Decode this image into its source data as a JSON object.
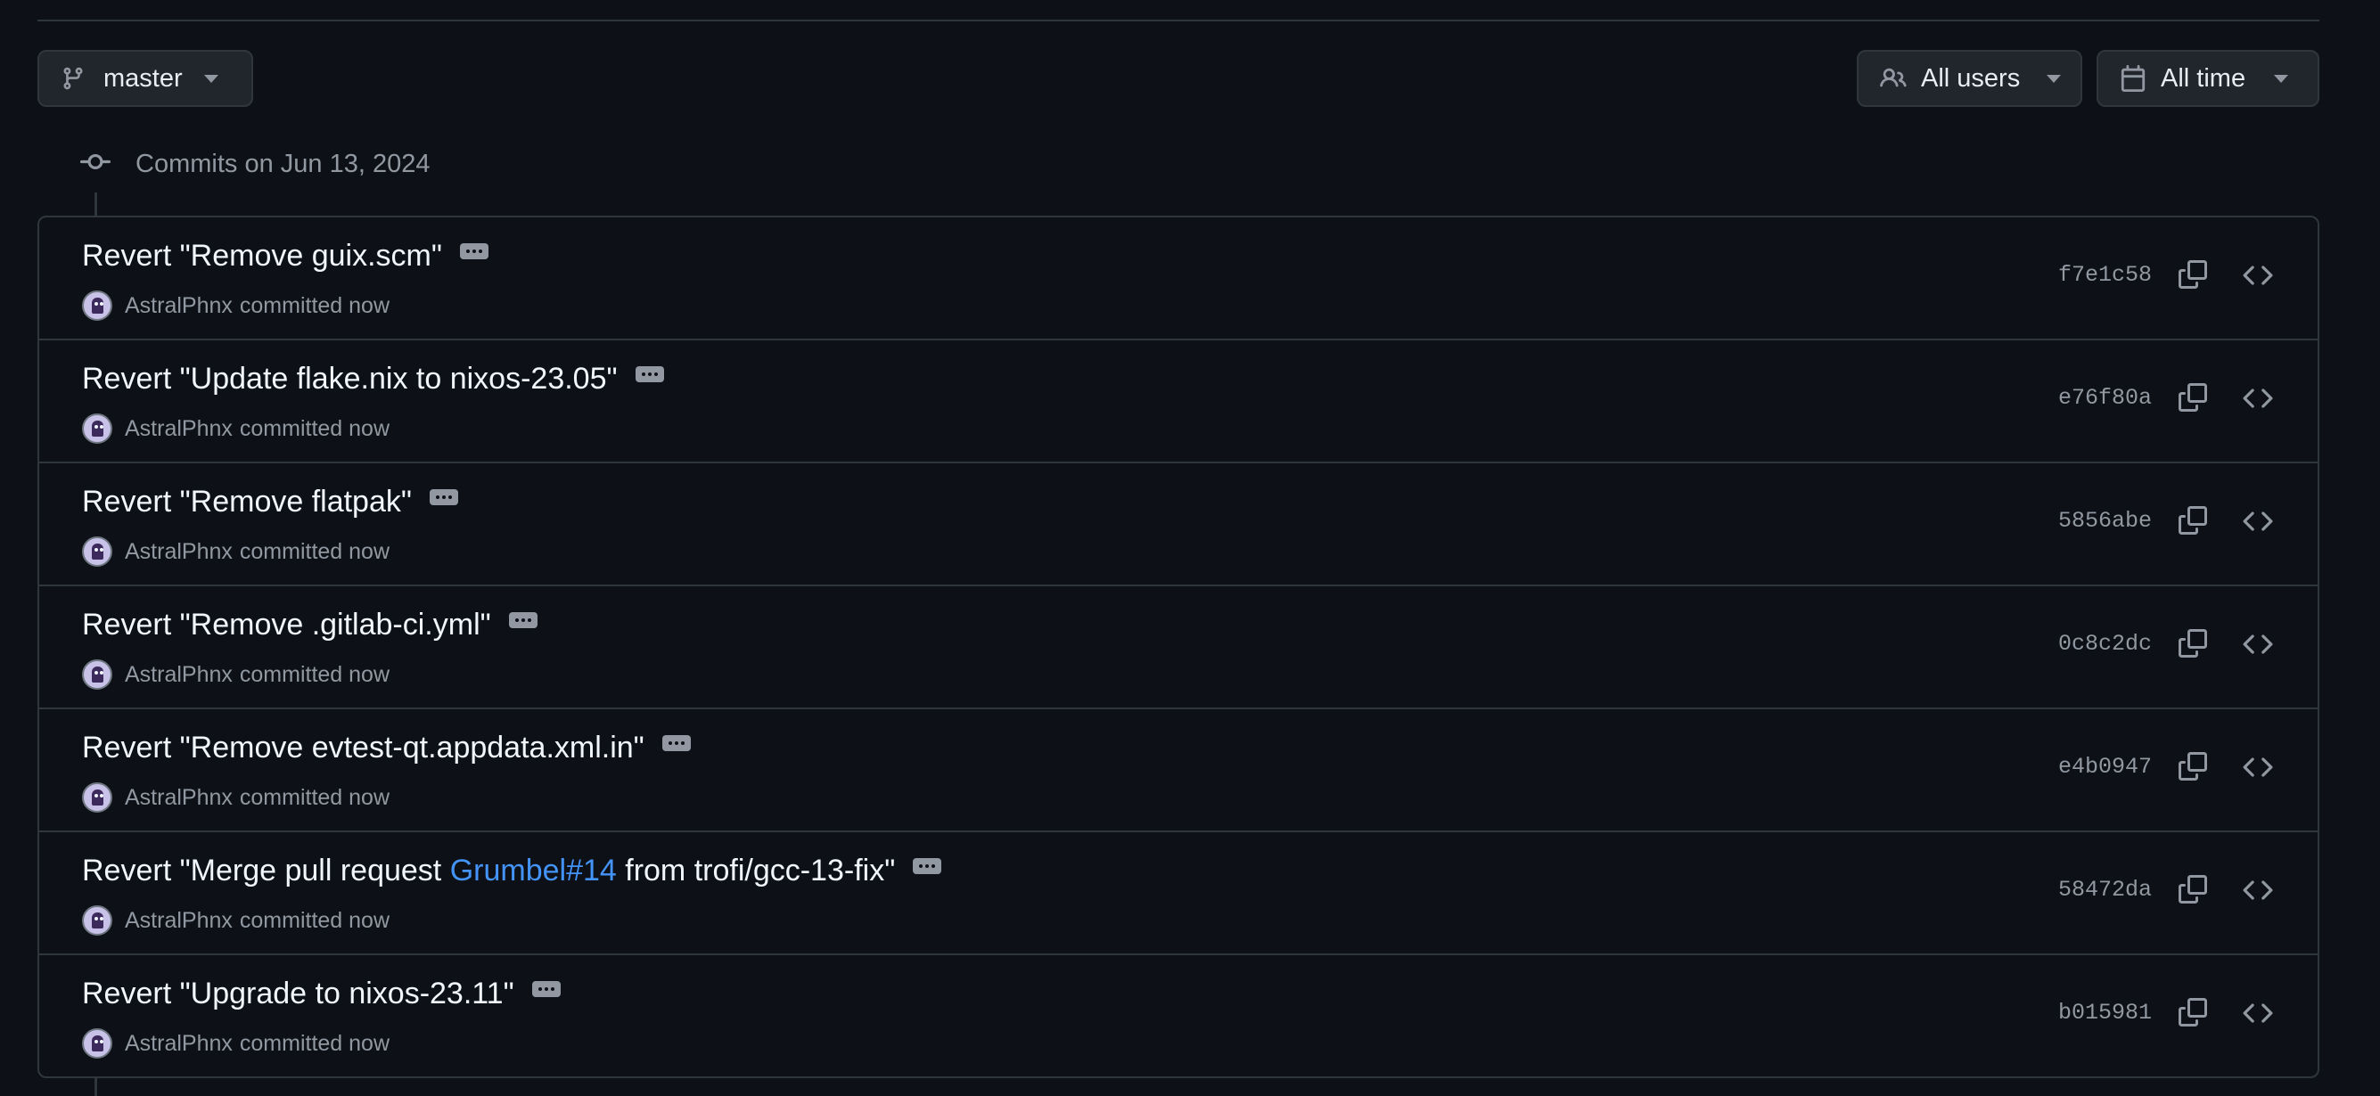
{
  "toolbar": {
    "branch_label": "master",
    "users_label": "All users",
    "time_label": "All time"
  },
  "group": {
    "title": "Commits on Jun 13, 2024"
  },
  "commits": [
    {
      "title_parts": [
        "Revert \"Remove guix.scm\""
      ],
      "author": "AstralPhnx",
      "action": "committed now",
      "sha": "f7e1c58"
    },
    {
      "title_parts": [
        "Revert \"Update flake.nix to nixos-23.05\""
      ],
      "author": "AstralPhnx",
      "action": "committed now",
      "sha": "e76f80a"
    },
    {
      "title_parts": [
        "Revert \"Remove flatpak\""
      ],
      "author": "AstralPhnx",
      "action": "committed now",
      "sha": "5856abe"
    },
    {
      "title_parts": [
        "Revert \"Remove .gitlab-ci.yml\""
      ],
      "author": "AstralPhnx",
      "action": "committed now",
      "sha": "0c8c2dc"
    },
    {
      "title_parts": [
        "Revert \"Remove evtest-qt.appdata.xml.in\""
      ],
      "author": "AstralPhnx",
      "action": "committed now",
      "sha": "e4b0947"
    },
    {
      "title_parts": [
        "Revert \"Merge pull request ",
        "Grumbel#14",
        " from trofi/gcc-13-fix\""
      ],
      "link_index": 1,
      "author": "AstralPhnx",
      "action": "committed now",
      "sha": "58472da"
    },
    {
      "title_parts": [
        "Revert \"Upgrade to nixos-23.11\""
      ],
      "author": "AstralPhnx",
      "action": "committed now",
      "sha": "b015981"
    }
  ],
  "colors": {
    "background": "#0d1117",
    "border": "#30363d",
    "link": "#4493f8",
    "muted": "#9198a1",
    "text": "#f0f6fc"
  },
  "icons": {
    "branch": "git-branch-icon",
    "users": "people-icon",
    "calendar": "calendar-icon",
    "commit": "git-commit-icon",
    "copy": "copy-icon",
    "browse": "code-icon"
  }
}
